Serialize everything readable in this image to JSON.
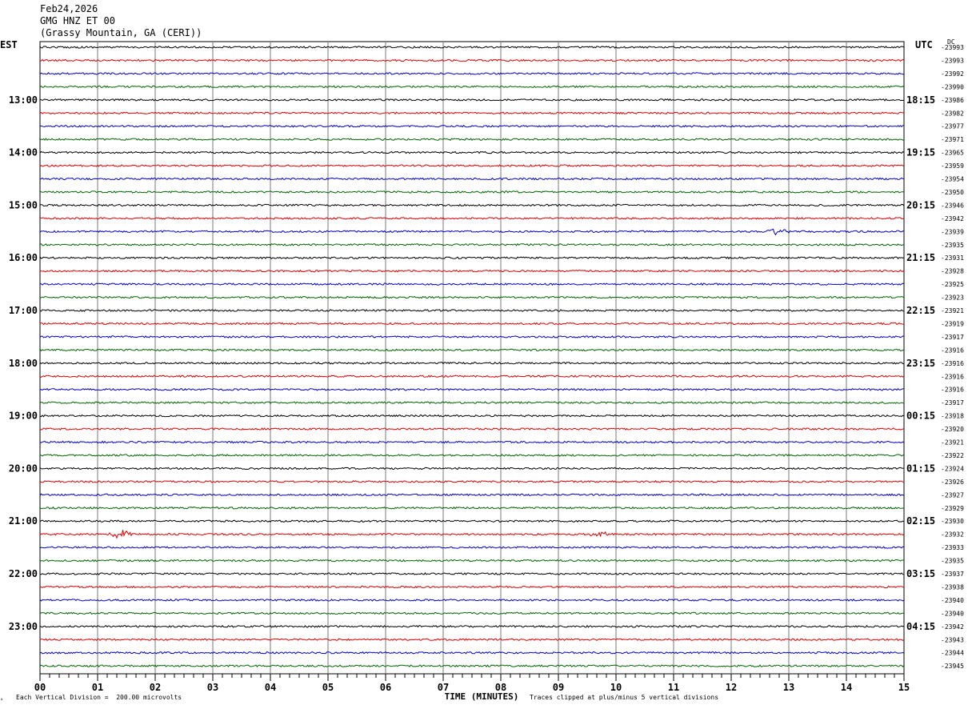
{
  "header": {
    "date": "Feb24,2026",
    "station": "GMG HNZ ET 00",
    "location": "(Grassy Mountain, GA (CERI))"
  },
  "left_zone_label": "EST",
  "right_zone_label": "UTC",
  "dc_label": "DC",
  "footer": {
    "scale_note": "Each Vertical Division =  200.00 microvolts",
    "clip_note": "Traces clipped at plus/minus 5 vertical divisions"
  },
  "chart_data": {
    "type": "line",
    "title": "GMG HNZ ET 00",
    "xlabel": "TIME (MINUTES)",
    "ylabel": "",
    "x_ticks": [
      "00",
      "01",
      "02",
      "03",
      "04",
      "05",
      "06",
      "07",
      "08",
      "09",
      "10",
      "11",
      "12",
      "13",
      "14",
      "15"
    ],
    "xlim": [
      0,
      15
    ],
    "trace_colors": [
      "#000000",
      "#e00000",
      "#0000cc",
      "#006400"
    ],
    "est_labels": [
      "13:00",
      "14:00",
      "15:00",
      "16:00",
      "17:00",
      "18:00",
      "19:00",
      "20:00",
      "21:00",
      "22:00",
      "23:00"
    ],
    "utc_labels": [
      "18:15",
      "19:15",
      "20:15",
      "21:15",
      "22:15",
      "23:15",
      "00:15",
      "01:15",
      "02:15",
      "03:15",
      "04:15"
    ],
    "dc_offsets": [
      "-23993",
      "-23993",
      "-23992",
      "-23990",
      "-23986",
      "-23982",
      "-23977",
      "-23971",
      "-23965",
      "-23959",
      "-23954",
      "-23950",
      "-23946",
      "-23942",
      "-23939",
      "-23935",
      "-23931",
      "-23928",
      "-23925",
      "-23923",
      "-23921",
      "-23919",
      "-23917",
      "-23916",
      "-23916",
      "-23916",
      "-23916",
      "-23917",
      "-23918",
      "-23920",
      "-23921",
      "-23922",
      "-23924",
      "-23926",
      "-23927",
      "-23929",
      "-23930",
      "-23932",
      "-23933",
      "-23935",
      "-23937",
      "-23938",
      "-23940",
      "-23940",
      "-23942",
      "-23943",
      "-23944",
      "-23945"
    ],
    "events": [
      {
        "trace": 37,
        "minute": 1.4,
        "amplitude": 0.8
      },
      {
        "trace": 37,
        "minute": 9.7,
        "amplitude": 0.5
      },
      {
        "trace": 14,
        "minute": 12.8,
        "amplitude": 0.6
      }
    ]
  }
}
